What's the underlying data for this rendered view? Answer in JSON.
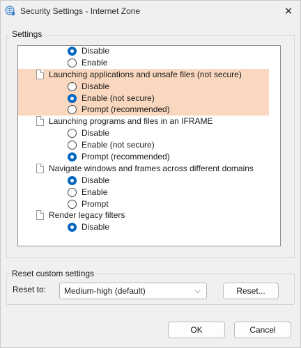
{
  "window": {
    "title": "Security Settings - Internet Zone"
  },
  "settings_group": {
    "label": "Settings"
  },
  "settings_list": [
    {
      "type": "option",
      "label": "Disable",
      "checked": true,
      "highlight": false
    },
    {
      "type": "option",
      "label": "Enable",
      "checked": false,
      "highlight": false
    },
    {
      "type": "heading",
      "label": "Launching applications and unsafe files (not secure)",
      "highlight": true
    },
    {
      "type": "option",
      "label": "Disable",
      "checked": false,
      "highlight": true
    },
    {
      "type": "option",
      "label": "Enable (not secure)",
      "checked": true,
      "highlight": true
    },
    {
      "type": "option",
      "label": "Prompt (recommended)",
      "checked": false,
      "highlight": true
    },
    {
      "type": "heading",
      "label": "Launching programs and files in an IFRAME",
      "highlight": false
    },
    {
      "type": "option",
      "label": "Disable",
      "checked": false,
      "highlight": false
    },
    {
      "type": "option",
      "label": "Enable (not secure)",
      "checked": false,
      "highlight": false
    },
    {
      "type": "option",
      "label": "Prompt (recommended)",
      "checked": true,
      "highlight": false
    },
    {
      "type": "heading",
      "label": "Navigate windows and frames across different domains",
      "highlight": false
    },
    {
      "type": "option",
      "label": "Disable",
      "checked": true,
      "highlight": false
    },
    {
      "type": "option",
      "label": "Enable",
      "checked": false,
      "highlight": false
    },
    {
      "type": "option",
      "label": "Prompt",
      "checked": false,
      "highlight": false
    },
    {
      "type": "heading",
      "label": "Render legacy filters",
      "highlight": false
    },
    {
      "type": "option",
      "label": "Disable",
      "checked": true,
      "highlight": false
    }
  ],
  "reset_group": {
    "label": "Reset custom settings",
    "reset_to_label": "Reset to:",
    "selected_level": "Medium-high (default)",
    "reset_button": "Reset..."
  },
  "dialog_buttons": {
    "ok": "OK",
    "cancel": "Cancel"
  },
  "colors": {
    "highlight": "#fad8bf",
    "radio_checked": "#0067c0"
  },
  "icons": {
    "title": "globe-shield-icon",
    "close": "close-icon",
    "entry": "page-icon",
    "dropdown": "chevron-down-icon"
  }
}
